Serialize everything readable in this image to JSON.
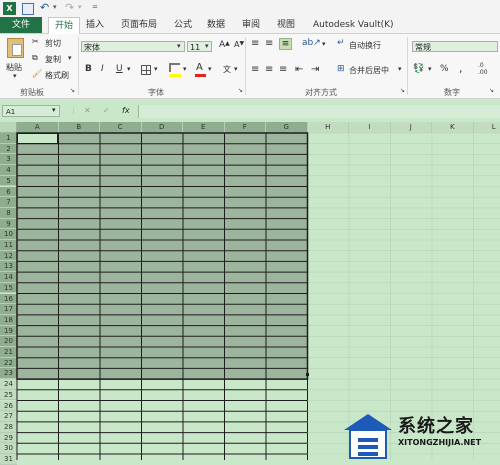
{
  "tabs": {
    "file": "文件",
    "home": "开始",
    "insert": "插入",
    "layout": "页面布局",
    "formulas": "公式",
    "data": "数据",
    "review": "审阅",
    "view": "视图",
    "vault": "Autodesk Vault(K)"
  },
  "clipboard": {
    "paste": "粘贴",
    "cut": "剪切",
    "copy": "复制",
    "format_painter": "格式刷",
    "group": "剪贴板"
  },
  "font": {
    "name": "宋体",
    "size": "11",
    "bold": "B",
    "italic": "I",
    "underline": "U",
    "group": "字体",
    "color_letter": "A",
    "size_up": "A",
    "size_down": "A"
  },
  "alignment": {
    "wrap": "自动换行",
    "merge": "合并后居中",
    "group": "对齐方式"
  },
  "number": {
    "format": "常规",
    "percent": "%",
    "comma": ",",
    "group": "数字"
  },
  "formula_bar": {
    "name_box": "A1",
    "fx": "fx"
  },
  "columns": [
    "A",
    "B",
    "C",
    "D",
    "E",
    "F",
    "G",
    "H",
    "I",
    "J",
    "K",
    "L"
  ],
  "rows": [
    "1",
    "2",
    "3",
    "4",
    "5",
    "6",
    "7",
    "8",
    "9",
    "10",
    "11",
    "12",
    "13",
    "14",
    "15",
    "16",
    "17",
    "18",
    "19",
    "20",
    "21",
    "22",
    "23",
    "24",
    "25",
    "26",
    "27",
    "28",
    "29",
    "30",
    "31"
  ],
  "watermark": {
    "cn": "系统之家",
    "en": "XITONGZHIJIA.NET"
  },
  "colors": {
    "accent": "#217346",
    "selection": "#9db49d",
    "sheet_bg": "#c9e7c9"
  }
}
